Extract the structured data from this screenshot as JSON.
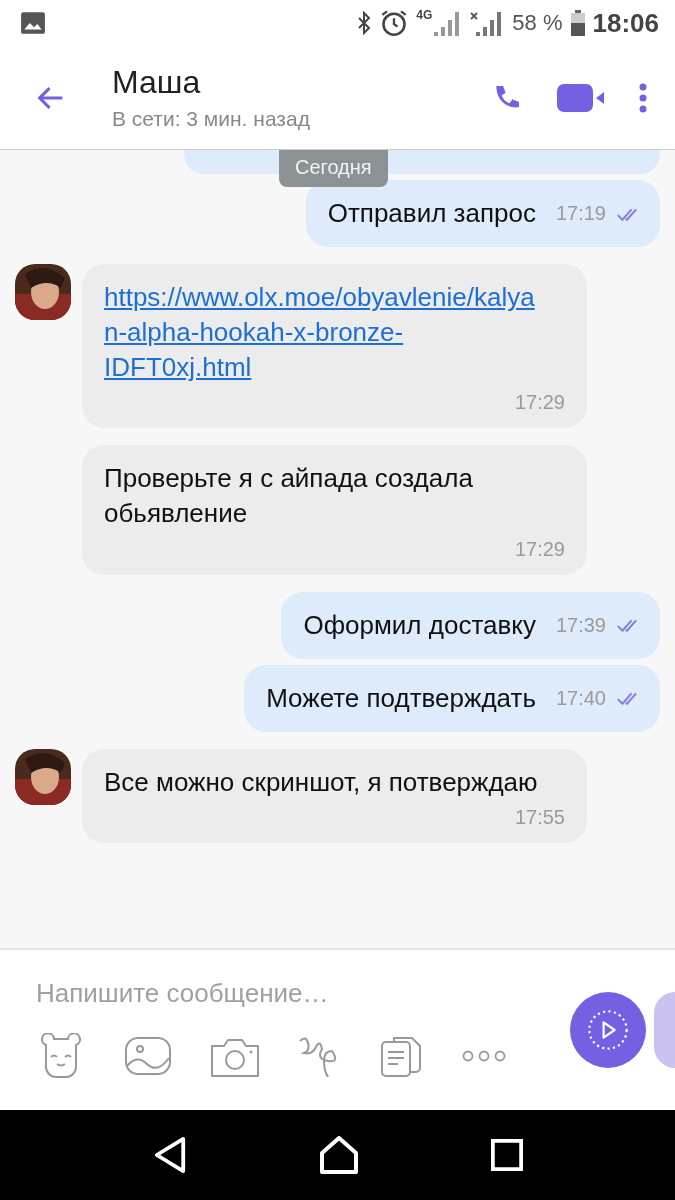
{
  "status_bar": {
    "network": "4G",
    "battery": "58 %",
    "time": "18:06"
  },
  "header": {
    "title": "Маша",
    "subtitle": "В сети: 3 мин. назад"
  },
  "date_chip": "Сегодня",
  "messages": [
    {
      "kind": "fragment"
    },
    {
      "kind": "out",
      "text": "Отправил запрос",
      "time": "17:19"
    },
    {
      "kind": "in",
      "link": true,
      "avatar": true,
      "text": "https://www.olx.moe/obyavlenie/kalyan-alpha-hookah-x-bronze-IDFT0xj.html",
      "time": "17:29"
    },
    {
      "kind": "in",
      "link": false,
      "avatar": false,
      "text": "Проверьте я с айпада создала обьявление",
      "time": "17:29"
    },
    {
      "kind": "out",
      "text": "Оформил доставку",
      "time": "17:39"
    },
    {
      "kind": "out",
      "text": "Можете подтверждать",
      "time": "17:40"
    },
    {
      "kind": "in",
      "link": false,
      "avatar": true,
      "text": "Все можно скриншот, я потверждаю",
      "time": "17:55"
    }
  ],
  "composer": {
    "placeholder": "Напишите сообщение…"
  }
}
